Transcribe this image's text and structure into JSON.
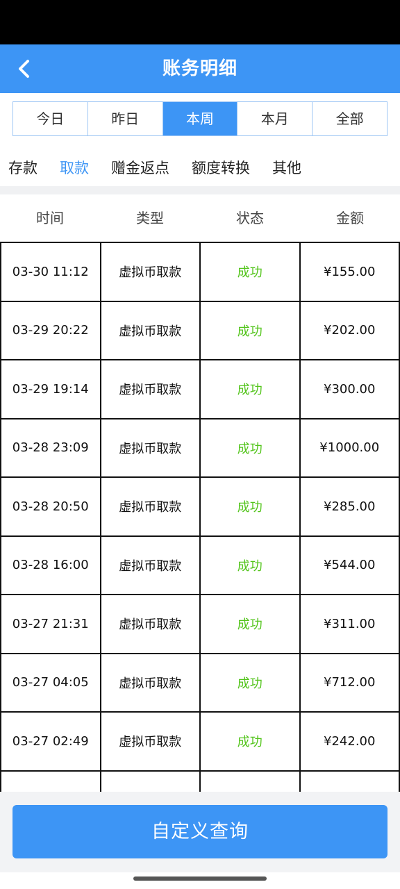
{
  "header": {
    "title": "账务明细"
  },
  "period_tabs": [
    {
      "label": "今日"
    },
    {
      "label": "昨日"
    },
    {
      "label": "本周"
    },
    {
      "label": "本月"
    },
    {
      "label": "全部"
    }
  ],
  "active_period": "本周",
  "category_tabs": [
    {
      "label": "存款"
    },
    {
      "label": "取款"
    },
    {
      "label": "赠金返点"
    },
    {
      "label": "额度转换"
    },
    {
      "label": "其他"
    }
  ],
  "active_category": "取款",
  "table": {
    "columns": [
      "时间",
      "类型",
      "状态",
      "金额"
    ],
    "rows": [
      {
        "time": "03-30 11:12",
        "type": "虚拟币取款",
        "status": "成功",
        "amount": "¥155.00"
      },
      {
        "time": "03-29 20:22",
        "type": "虚拟币取款",
        "status": "成功",
        "amount": "¥202.00"
      },
      {
        "time": "03-29 19:14",
        "type": "虚拟币取款",
        "status": "成功",
        "amount": "¥300.00"
      },
      {
        "time": "03-28 23:09",
        "type": "虚拟币取款",
        "status": "成功",
        "amount": "¥1000.00"
      },
      {
        "time": "03-28 20:50",
        "type": "虚拟币取款",
        "status": "成功",
        "amount": "¥285.00"
      },
      {
        "time": "03-28 16:00",
        "type": "虚拟币取款",
        "status": "成功",
        "amount": "¥544.00"
      },
      {
        "time": "03-27 21:31",
        "type": "虚拟币取款",
        "status": "成功",
        "amount": "¥311.00"
      },
      {
        "time": "03-27 04:05",
        "type": "虚拟币取款",
        "status": "成功",
        "amount": "¥712.00"
      },
      {
        "time": "03-27 02:49",
        "type": "虚拟币取款",
        "status": "成功",
        "amount": "¥242.00"
      },
      {
        "time": "",
        "type": "",
        "status": "",
        "amount": ""
      }
    ]
  },
  "footer": {
    "query_label": "自定义查询"
  },
  "colors": {
    "primary": "#3d95f5",
    "success": "#52c41a"
  },
  "icons": {
    "back": "chevron-left-icon"
  }
}
